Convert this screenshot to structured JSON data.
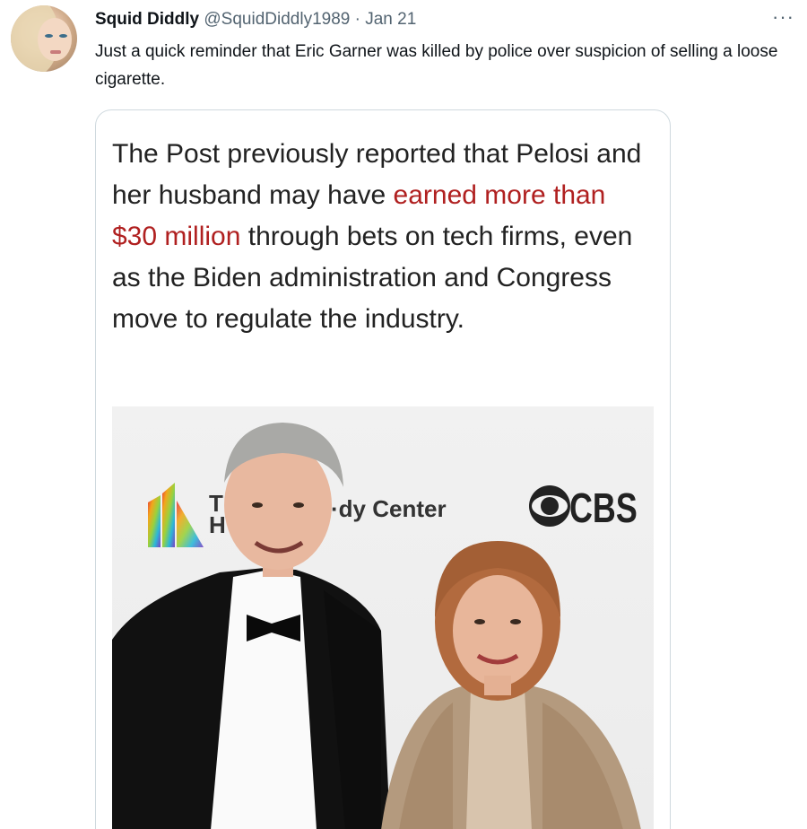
{
  "tweet": {
    "author_name": "Squid Diddly",
    "author_handle": "@SquidDiddly1989",
    "separator": "·",
    "date": "Jan 21",
    "more_label": "···",
    "text": "Just a quick reminder that Eric Garner was killed by police over suspicion of selling a loose cigarette."
  },
  "quote_card": {
    "text_before": "The Post previously reported that Pelosi and her husband may have ",
    "text_highlight": "earned more than $30 million",
    "text_after": " through bets on tech firms, even as the Biden administration and Congress move to regulate the industry.",
    "highlight_color": "#b02020"
  },
  "photo": {
    "backdrop_text": "·dy Center",
    "backdrop_fragment": "T\nH",
    "sponsor_logo": "CBS"
  },
  "icons": {
    "avatar": "profile-photo",
    "more": "more-options-icon",
    "cbs": "cbs-eye-logo",
    "rainbow": "kennedy-center-rainbow-logo"
  }
}
